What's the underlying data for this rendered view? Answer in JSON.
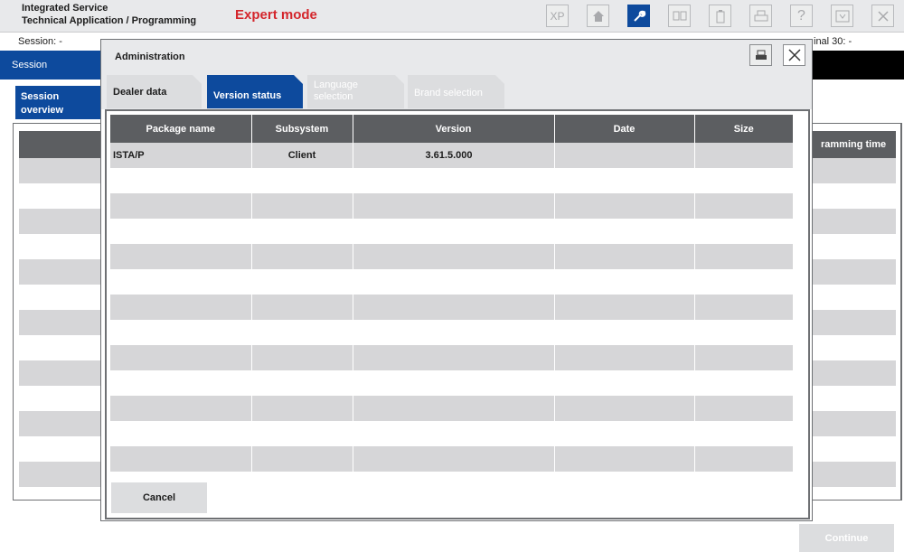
{
  "app": {
    "title_line1": "Integrated Service",
    "title_line2": "Technical Application / Programming",
    "mode": "Expert mode"
  },
  "toolbar": {
    "icons": [
      "xp-icon",
      "home-icon",
      "wrench-icon",
      "diagnostics-icon",
      "battery-icon",
      "print-icon",
      "help-icon",
      "download-icon",
      "close-icon"
    ],
    "xp_label": "XP",
    "help_label": "?"
  },
  "info": {
    "session": "Session:  -",
    "terminal": "inal 30:  -"
  },
  "background": {
    "band_label": "Session",
    "tab_line1": "Session",
    "tab_line2": "overview",
    "column_header": "ramming time",
    "continue_label": "Continue"
  },
  "dialog": {
    "title": "Administration",
    "tabs": [
      {
        "line1": "Dealer data",
        "line2": ""
      },
      {
        "line1": "Version status",
        "line2": ""
      },
      {
        "line1": "Language",
        "line2": "selection"
      },
      {
        "line1": "Brand selection",
        "line2": ""
      }
    ],
    "active_tab": "Version status",
    "table": {
      "columns": [
        "Package name",
        "Subsystem",
        "Version",
        "Date",
        "Size"
      ],
      "rows": [
        {
          "package": "ISTA/P",
          "subsystem": "Client",
          "version": "3.61.5.000",
          "date": "",
          "size": ""
        }
      ]
    },
    "cancel_label": "Cancel"
  },
  "colors": {
    "accent_blue": "#0d4a9d",
    "header_gray": "#5c5e61",
    "row_gray": "#d6d6d8",
    "mode_red": "#d4262c"
  }
}
